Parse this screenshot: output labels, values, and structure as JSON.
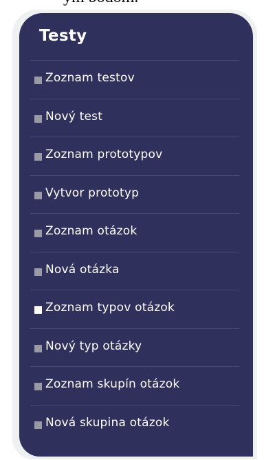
{
  "caption": "ým bodom.",
  "colors": {
    "panel_bg": "#30305c",
    "outer_bg": "#eef0f2",
    "bullet_inactive": "#9a9aa6",
    "bullet_active": "#ffffff",
    "text": "#ffffff"
  },
  "menu": {
    "title": "Testy",
    "items": [
      {
        "label": "Zoznam testov",
        "icon": "square-bullet-icon",
        "active": false
      },
      {
        "label": "Nový test",
        "icon": "square-bullet-icon",
        "active": false
      },
      {
        "label": "Zoznam prototypov",
        "icon": "square-bullet-icon",
        "active": false
      },
      {
        "label": "Vytvor prototyp",
        "icon": "square-bullet-icon",
        "active": false
      },
      {
        "label": "Zoznam otázok",
        "icon": "square-bullet-icon",
        "active": false
      },
      {
        "label": "Nová otázka",
        "icon": "square-bullet-icon",
        "active": false
      },
      {
        "label": "Zoznam typov otázok",
        "icon": "square-bullet-icon",
        "active": true
      },
      {
        "label": "Nový typ otázky",
        "icon": "square-bullet-icon",
        "active": false
      },
      {
        "label": "Zoznam skupín otázok",
        "icon": "square-bullet-icon",
        "active": false
      },
      {
        "label": "Nová skupina otázok",
        "icon": "square-bullet-icon",
        "active": false
      }
    ]
  }
}
